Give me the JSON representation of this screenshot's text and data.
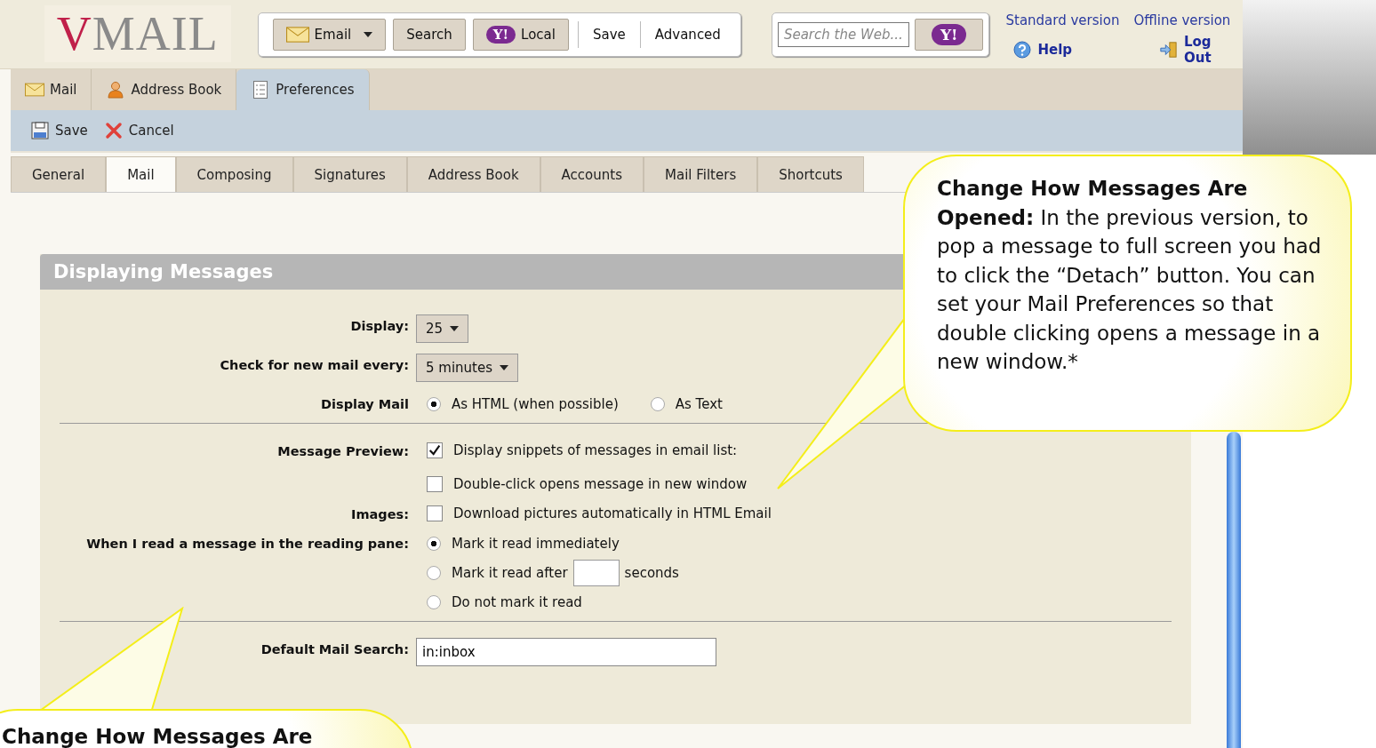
{
  "logo": {
    "initial": "V",
    "rest": "MAIL"
  },
  "toolbar": [
    {
      "kind": "dropdown",
      "label": "Email"
    },
    {
      "kind": "button",
      "label": "Search"
    },
    {
      "kind": "brand",
      "mark": "Y!",
      "label": "Local"
    },
    {
      "kind": "link",
      "label": "Save"
    },
    {
      "kind": "link",
      "label": "Advanced"
    }
  ],
  "web_search": {
    "placeholder": "Search the Web...",
    "button_mark": "Y!"
  },
  "top_links": [
    {
      "label": "Standard version"
    },
    {
      "label": "Offline version"
    }
  ],
  "help": "Help",
  "logout": "Log Out",
  "nav_tabs": [
    {
      "kind": "mail",
      "label": "Mail",
      "selected": false
    },
    {
      "kind": "contacts",
      "label": "Address Book",
      "selected": false
    },
    {
      "kind": "preferences",
      "label": "Preferences",
      "selected": true
    }
  ],
  "actions": [
    {
      "kind": "save",
      "label": "Save"
    },
    {
      "kind": "cancel",
      "label": "Cancel"
    }
  ],
  "sub_tabs": [
    {
      "label": "General",
      "selected": false
    },
    {
      "label": "Mail",
      "selected": true
    },
    {
      "label": "Composing",
      "selected": false
    },
    {
      "label": "Signatures",
      "selected": false
    },
    {
      "label": "Address Book",
      "selected": false
    },
    {
      "label": "Accounts",
      "selected": false
    },
    {
      "label": "Mail Filters",
      "selected": false
    },
    {
      "label": "Shortcuts",
      "selected": false
    }
  ],
  "section": {
    "title": "Displaying Messages",
    "groups": [
      [
        {
          "kind": "select",
          "label": "Display:",
          "value": "25"
        },
        {
          "kind": "select",
          "label": "Check for new mail every:",
          "value": "5 minutes"
        },
        {
          "kind": "radios",
          "label": "Display Mail",
          "options": [
            {
              "label": "As HTML (when possible)",
              "selected": true
            },
            {
              "label": "As Text",
              "selected": false
            }
          ]
        }
      ],
      [
        {
          "kind": "checks",
          "label": "Message Preview:",
          "options": [
            {
              "label": "Display snippets of messages in email list:",
              "checked": true
            },
            {
              "label": "Double-click opens message in new window",
              "checked": false
            }
          ]
        },
        {
          "kind": "checks",
          "label": "Images:",
          "options": [
            {
              "label": "Download pictures automatically in HTML Email",
              "checked": false
            }
          ]
        },
        {
          "kind": "radio_list",
          "label": "When I read a message in the reading pane:",
          "options": [
            {
              "label": "Mark it read immediately",
              "selected": true
            },
            {
              "label": "Mark it read after",
              "suffix": "seconds",
              "selected": false
            },
            {
              "label": "Do not mark it read",
              "selected": false
            }
          ]
        }
      ],
      [
        {
          "kind": "text",
          "label": "Default Mail Search:",
          "value": "in:inbox"
        }
      ]
    ]
  },
  "callouts": [
    {
      "text": "**Change How Messages Are Opened:** In the previous version, to pop a message to full screen you had to click the “Detach” button.  You can set your Mail Preferences so that double clicking opens a message in a new window.*"
    },
    {
      "text": "Change How Messages Are"
    }
  ]
}
